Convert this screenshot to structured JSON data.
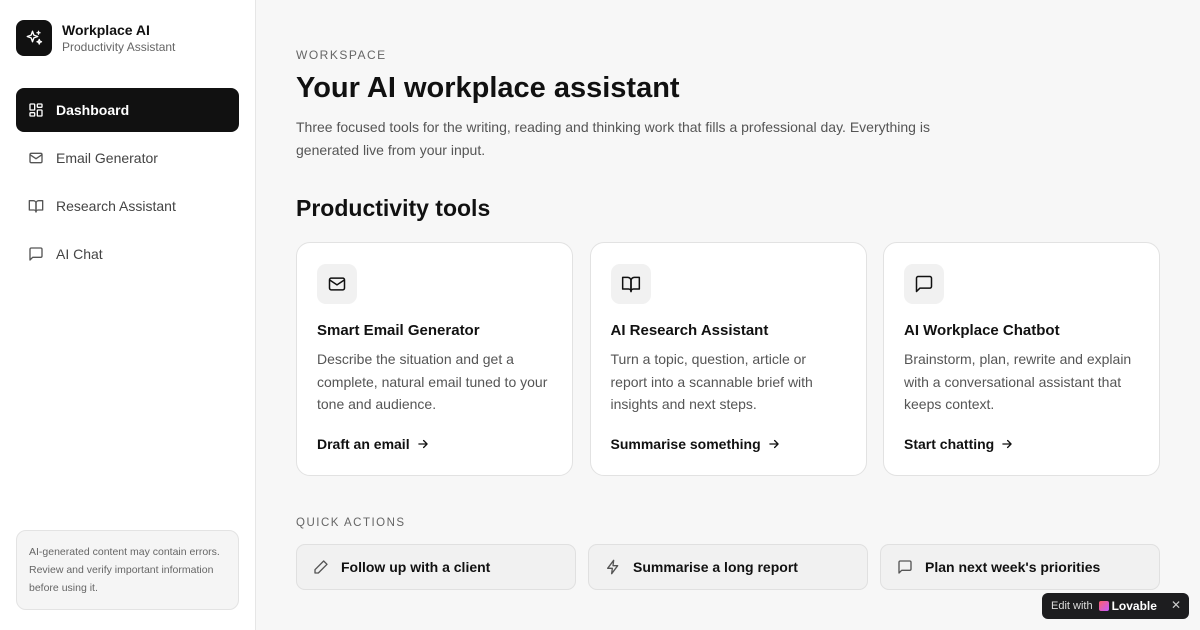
{
  "brand": {
    "title": "Workplace AI",
    "subtitle": "Productivity Assistant"
  },
  "nav": [
    {
      "label": "Dashboard",
      "icon": "layout-dashboard-icon",
      "active": true
    },
    {
      "label": "Email Generator",
      "icon": "mail-icon",
      "active": false
    },
    {
      "label": "Research Assistant",
      "icon": "book-open-icon",
      "active": false
    },
    {
      "label": "AI Chat",
      "icon": "message-square-icon",
      "active": false
    }
  ],
  "disclaimer": "AI-generated content may contain errors. Review and verify important information before using it.",
  "header": {
    "eyebrow": "WORKSPACE",
    "title": "Your AI workplace assistant",
    "description": "Three focused tools for the writing, reading and thinking work that fills a professional day. Everything is generated live from your input."
  },
  "tools": {
    "title": "Productivity tools",
    "cards": [
      {
        "title": "Smart Email Generator",
        "description": "Describe the situation and get a complete, natural email tuned to your tone and audience.",
        "link": "Draft an email",
        "icon": "mail-icon"
      },
      {
        "title": "AI Research Assistant",
        "description": "Turn a topic, question, article or report into a scannable brief with insights and next steps.",
        "link": "Summarise something",
        "icon": "book-open-icon"
      },
      {
        "title": "AI Workplace Chatbot",
        "description": "Brainstorm, plan, rewrite and explain with a conversational assistant that keeps context.",
        "link": "Start chatting",
        "icon": "message-square-icon"
      }
    ]
  },
  "quick_actions": {
    "label": "QUICK ACTIONS",
    "items": [
      {
        "label": "Follow up with a client",
        "icon": "pencil-icon"
      },
      {
        "label": "Summarise a long report",
        "icon": "zap-icon"
      },
      {
        "label": "Plan next week's priorities",
        "icon": "message-square-icon"
      }
    ]
  },
  "badge": {
    "prefix": "Edit with",
    "brand": "Lovable",
    "close": "✕"
  },
  "colors": {
    "accent": "#111111",
    "background": "#f7f7f7",
    "card": "#ffffff",
    "muted": "#666666"
  }
}
